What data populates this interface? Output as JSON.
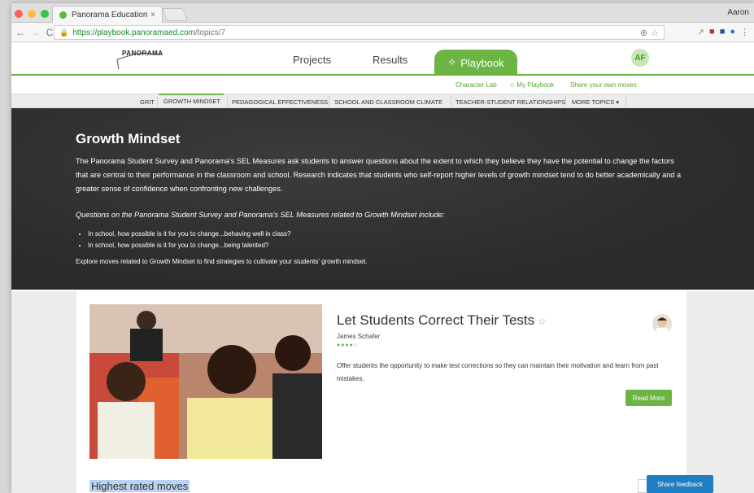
{
  "browser": {
    "tab_title": "Panorama Education",
    "profile": "Aaron",
    "url_host": "https://playbook.panoramaed.com",
    "url_path": "/topics/7"
  },
  "header": {
    "logo_text": "PANORAMA",
    "nav_projects": "Projects",
    "nav_results": "Results",
    "nav_playbook": "Playbook",
    "avatar_initials": "AF"
  },
  "sublinks": {
    "character_lab": "Character Lab",
    "my_playbook": "My Playbook",
    "share_moves": "Share your own moves"
  },
  "topics": [
    "GRIT",
    "GROWTH MINDSET",
    "PEDAGOGICAL EFFECTIVENESS",
    "SCHOOL AND CLASSROOM CLIMATE",
    "TEACHER-STUDENT RELATIONSHIPS",
    "MORE TOPICS"
  ],
  "hero": {
    "title": "Growth Mindset",
    "description": "The Panorama Student Survey and Panorama's SEL Measures ask students to answer questions about the extent to which they believe they have the potential to change the factors that are central to their performance in the classroom and school. Research indicates that students who self-report higher levels of growth mindset tend to do better academically and a greater sense of confidence when confronting new challenges.",
    "questions_intro": "Questions on the Panorama Student Survey and Panorama's SEL Measures related to Growth Mindset include:",
    "questions": [
      "In school, how possible is it for you to change...behaving well in class?",
      "In school, how possible is it for you to change...being talented?"
    ],
    "explore": "Explore moves related to Growth Mindset to find strategies to cultivate your students' growth mindset."
  },
  "move": {
    "title": "Let Students Correct Their Tests",
    "author": "James Schafer",
    "summary": "Offer students the opportunity to make test corrections so they can maintain their motivation and learn from past mistakes.",
    "read_more": "Read More"
  },
  "section_heading": "Highest rated moves",
  "feedback_button": "Share feedback",
  "colors": {
    "brand_green": "#6cb545",
    "hero_bg": "#2f2f2f",
    "feedback_blue": "#1f7dc4"
  }
}
